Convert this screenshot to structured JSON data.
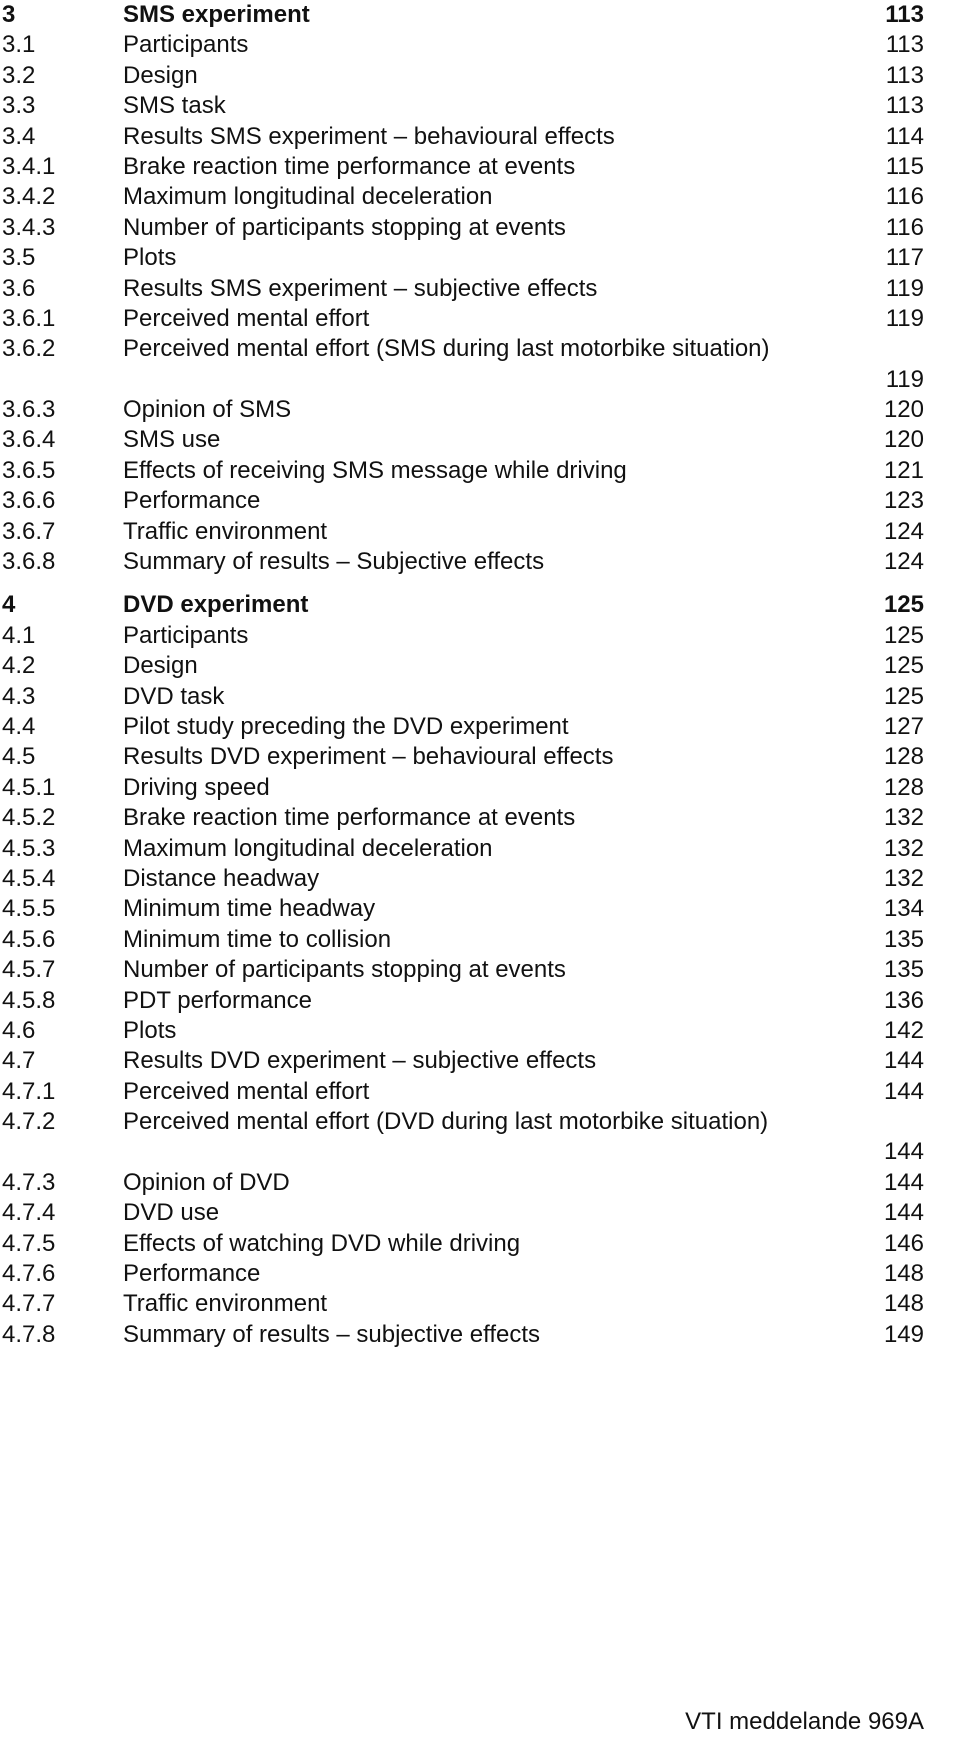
{
  "sections": [
    {
      "chapter": {
        "num": "3",
        "title": "SMS experiment",
        "page": "113"
      },
      "entries": [
        {
          "num": "3.1",
          "title": "Participants",
          "page": "113"
        },
        {
          "num": "3.2",
          "title": "Design",
          "page": "113"
        },
        {
          "num": "3.3",
          "title": "SMS task",
          "page": "113"
        },
        {
          "num": "3.4",
          "title": "Results SMS experiment – behavioural effects",
          "page": "114"
        },
        {
          "num": "3.4.1",
          "title": "Brake reaction time performance at events",
          "page": "115"
        },
        {
          "num": "3.4.2",
          "title": "Maximum longitudinal deceleration",
          "page": "116"
        },
        {
          "num": "3.4.3",
          "title": "Number of participants stopping at events",
          "page": "116"
        },
        {
          "num": "3.5",
          "title": "Plots",
          "page": "117"
        },
        {
          "num": "3.6",
          "title": "Results SMS experiment – subjective effects",
          "page": "119"
        },
        {
          "num": "3.6.1",
          "title": "Perceived mental effort",
          "page": "119"
        },
        {
          "num": "3.6.2",
          "title": "Perceived mental effort (SMS during last motorbike situation)",
          "page": "119"
        },
        {
          "num": "3.6.3",
          "title": "Opinion of SMS",
          "page": "120"
        },
        {
          "num": "3.6.4",
          "title": "SMS use",
          "page": "120"
        },
        {
          "num": "3.6.5",
          "title": "Effects of receiving SMS message while driving",
          "page": "121"
        },
        {
          "num": "3.6.6",
          "title": "Performance",
          "page": "123"
        },
        {
          "num": "3.6.7",
          "title": "Traffic environment",
          "page": "124"
        },
        {
          "num": "3.6.8",
          "title": "Summary of results – Subjective effects",
          "page": "124"
        }
      ]
    },
    {
      "chapter": {
        "num": "4",
        "title": "DVD experiment",
        "page": "125"
      },
      "entries": [
        {
          "num": "4.1",
          "title": "Participants",
          "page": "125"
        },
        {
          "num": "4.2",
          "title": "Design",
          "page": "125"
        },
        {
          "num": "4.3",
          "title": "DVD task",
          "page": "125"
        },
        {
          "num": "4.4",
          "title": "Pilot study preceding the DVD experiment",
          "page": "127"
        },
        {
          "num": "4.5",
          "title": "Results DVD experiment – behavioural effects",
          "page": "128"
        },
        {
          "num": "4.5.1",
          "title": "Driving speed",
          "page": "128"
        },
        {
          "num": "4.5.2",
          "title": "Brake reaction time performance at events",
          "page": "132"
        },
        {
          "num": "4.5.3",
          "title": "Maximum longitudinal deceleration",
          "page": "132"
        },
        {
          "num": "4.5.4",
          "title": "Distance headway",
          "page": "132"
        },
        {
          "num": "4.5.5",
          "title": "Minimum time headway",
          "page": "134"
        },
        {
          "num": "4.5.6",
          "title": "Minimum time to collision",
          "page": "135"
        },
        {
          "num": "4.5.7",
          "title": "Number of participants stopping at events",
          "page": "135"
        },
        {
          "num": "4.5.8",
          "title": "PDT performance",
          "page": "136"
        },
        {
          "num": "4.6",
          "title": "Plots",
          "page": "142"
        },
        {
          "num": "4.7",
          "title": "Results DVD experiment – subjective effects",
          "page": "144"
        },
        {
          "num": "4.7.1",
          "title": "Perceived mental effort",
          "page": "144"
        },
        {
          "num": "4.7.2",
          "title": "Perceived mental effort (DVD during last motorbike situation)",
          "page": "144"
        },
        {
          "num": "4.7.3",
          "title": "Opinion of DVD",
          "page": "144"
        },
        {
          "num": "4.7.4",
          "title": "DVD use",
          "page": "144"
        },
        {
          "num": "4.7.5",
          "title": "Effects of watching DVD while driving",
          "page": "146"
        },
        {
          "num": "4.7.6",
          "title": "Performance",
          "page": "148"
        },
        {
          "num": "4.7.7",
          "title": "Traffic environment",
          "page": "148"
        },
        {
          "num": "4.7.8",
          "title": "Summary of results – subjective effects",
          "page": "149"
        }
      ]
    }
  ],
  "footer": "VTI meddelande 969A"
}
